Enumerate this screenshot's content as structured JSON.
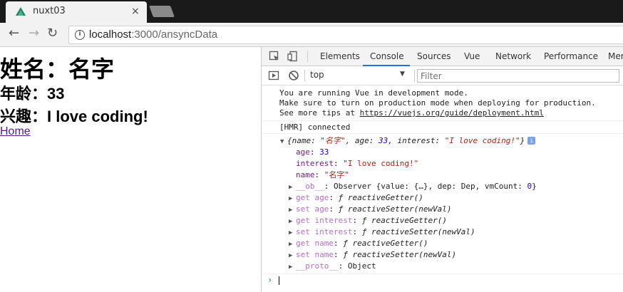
{
  "browser": {
    "tab_title": "nuxt03",
    "tab_close": "×",
    "url_host": "localhost",
    "url_rest": ":3000/ansyncData"
  },
  "page": {
    "name_line": "姓名：名字",
    "age_line": "年龄：33",
    "interest_line": "兴趣：I love coding!",
    "home_link": "Home"
  },
  "devtools": {
    "tabs": [
      "Elements",
      "Console",
      "Sources",
      "Vue",
      "Network",
      "Performance",
      "Mer"
    ],
    "active_tab": "Console",
    "context": "top",
    "filter_placeholder": "Filter",
    "vue_msg": [
      "You are running Vue in development mode.",
      "Make sure to turn on production mode when deploying for production.",
      "See more tips at "
    ],
    "vue_link": "https://vuejs.org/guide/deployment.html",
    "hmr_msg": "[HMR] connected",
    "object_preview": {
      "open": "{name: ",
      "name_val": "\"名字\"",
      "mid1": ", age: ",
      "age_val": "33",
      "mid2": ", interest: ",
      "interest_val": "\"I love coding!\"",
      "close": "}",
      "info": "i"
    },
    "props": [
      {
        "key": "age",
        "value": "33",
        "type": "num"
      },
      {
        "key": "interest",
        "value": "\"I love coding!\"",
        "type": "str"
      },
      {
        "key": "name",
        "value": "\"名字\"",
        "type": "str"
      }
    ],
    "ob_line": {
      "key": "__ob__",
      "rest": ": Observer {value: {…}, dep: Dep, vmCount: ",
      "num": "0",
      "end": "}"
    },
    "accessors": [
      {
        "key": "get age",
        "fn": "ƒ reactiveGetter()"
      },
      {
        "key": "set age",
        "fn": "ƒ reactiveSetter(newVal)"
      },
      {
        "key": "get interest",
        "fn": "ƒ reactiveGetter()"
      },
      {
        "key": "set interest",
        "fn": "ƒ reactiveSetter(newVal)"
      },
      {
        "key": "get name",
        "fn": "ƒ reactiveGetter()"
      },
      {
        "key": "set name",
        "fn": "ƒ reactiveSetter(newVal)"
      }
    ],
    "proto_line": {
      "key": "__proto__",
      "rest": ": Object"
    },
    "prompt": "›"
  },
  "colors": {
    "active_tab_underline": "#1a73e8",
    "key_purple": "#881391",
    "string_red": "#c41a16",
    "number_blue": "#1c00cf",
    "link_visited": "#551a8b"
  }
}
